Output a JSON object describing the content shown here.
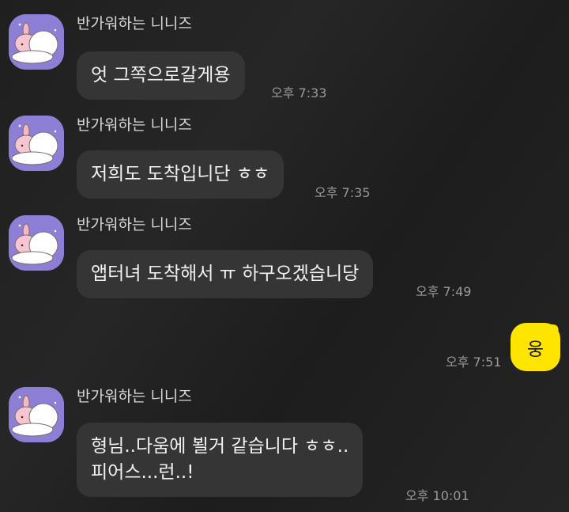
{
  "sender_name": "반가워하는 니니즈",
  "messages": [
    {
      "text": "엇 그쪽으로갈게용",
      "time": "오후 7:33"
    },
    {
      "text": "저희도 도착입니단 ㅎㅎ",
      "time": "오후 7:35"
    },
    {
      "text": "앱터녀 도착해서 ㅠ 하구오겠습니당",
      "time": "오후 7:49"
    },
    {
      "line1": "형님..다움에 뵐거 같습니다 ㅎㅎ..",
      "line2": "피어스...런..!",
      "time": "오후 10:01"
    }
  ],
  "my_message": {
    "text": "웅",
    "time": "오후 7:51"
  },
  "colors": {
    "background": "#232323",
    "bubble_other": "#353535",
    "bubble_mine": "#fee500",
    "avatar_bg": "#8e7fd6"
  },
  "icons": {
    "avatar": "bunny-hug-avatar-icon"
  }
}
